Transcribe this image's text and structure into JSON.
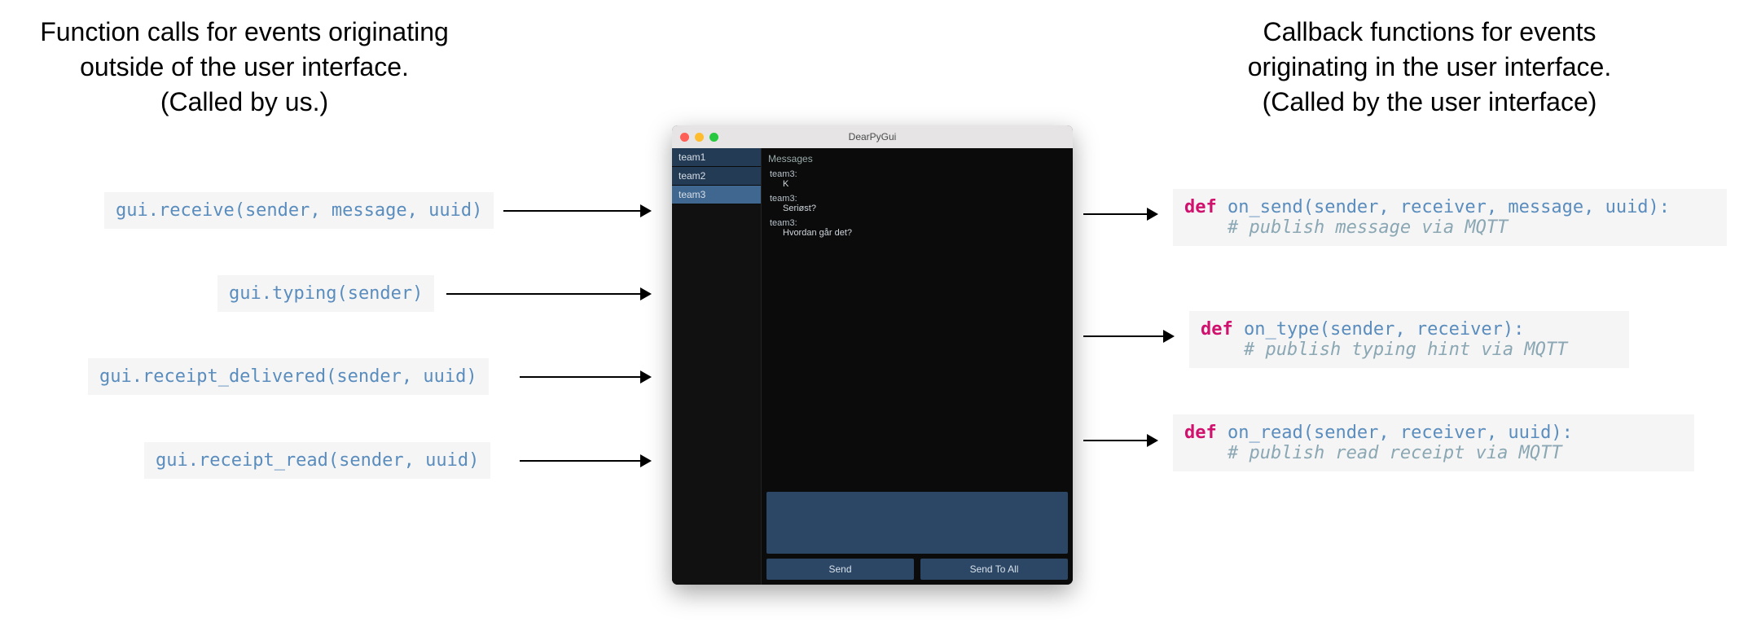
{
  "left_heading": "Function calls for events originating\noutside of the user interface.\n(Called by us.)",
  "right_heading": "Callback functions for events\noriginating in the user interface.\n(Called by the user interface)",
  "left_calls": {
    "receive": "gui.receive(sender, message, uuid)",
    "typing": "gui.typing(sender)",
    "receipt_delivered": "gui.receipt_delivered(sender, uuid)",
    "receipt_read": "gui.receipt_read(sender, uuid)"
  },
  "right_callbacks": {
    "on_send": {
      "kw": "def",
      "sig": " on_send(sender, receiver, message, uuid):",
      "comment": "    # publish message via MQTT"
    },
    "on_type": {
      "kw": "def",
      "sig": " on_type(sender, receiver):",
      "comment": "    # publish typing hint via MQTT"
    },
    "on_read": {
      "kw": "def",
      "sig": " on_read(sender, receiver, uuid):",
      "comment": "    # publish read receipt via MQTT"
    }
  },
  "app": {
    "title": "DearPyGui",
    "sidebar": [
      "team1",
      "team2",
      "team3"
    ],
    "sidebar_selected_index": 2,
    "messages_label": "Messages",
    "messages": [
      {
        "sender": "team3:",
        "text": "K"
      },
      {
        "sender": "team3:",
        "text": "Seriøst?"
      },
      {
        "sender": "team3:",
        "text": "Hvordan går det?"
      }
    ],
    "buttons": {
      "send": "Send",
      "send_all": "Send To All"
    }
  }
}
